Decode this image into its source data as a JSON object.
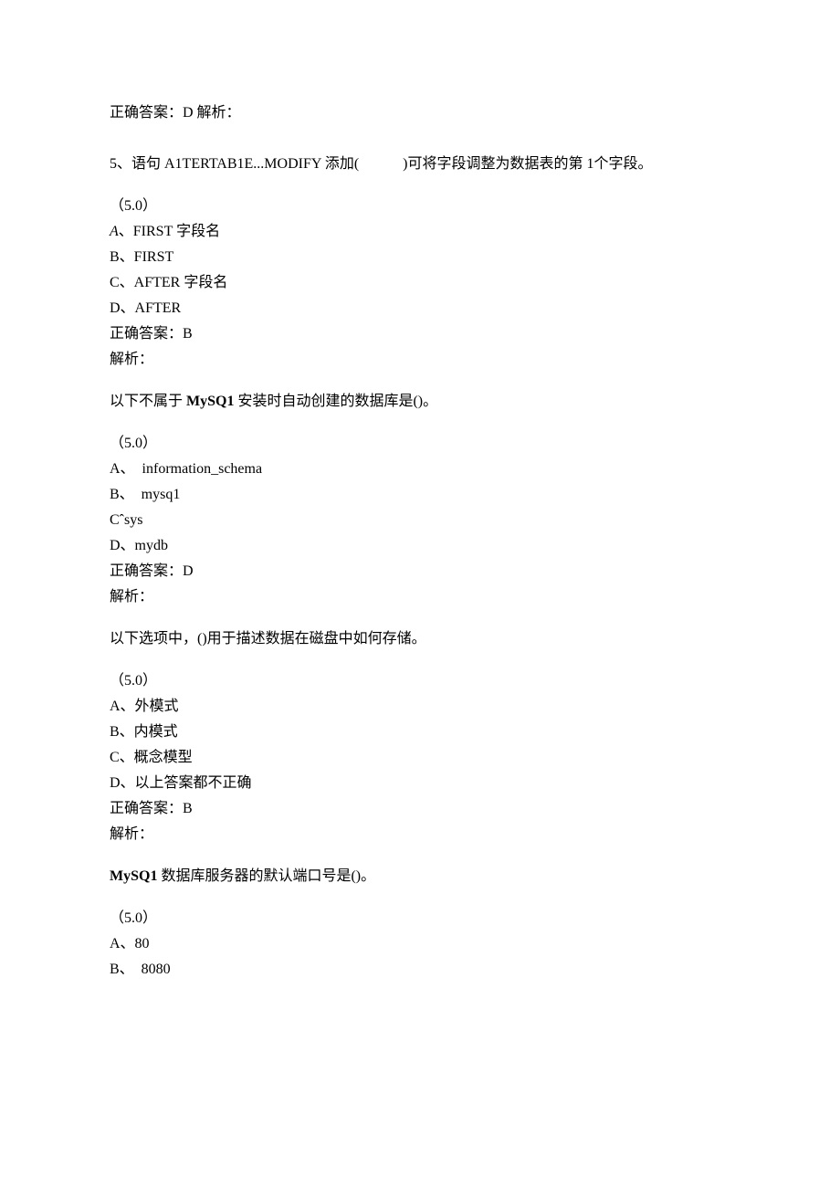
{
  "q4": {
    "answer_line": "正确答案：D 解析："
  },
  "q5": {
    "stem": "5、语句 A1TERTAB1E...MODIFY 添加(            )可将字段调整为数据表的第 1个字段。",
    "points": "（5.0）",
    "opt_a_label": "A",
    "opt_a_text": "、FIRST 字段名",
    "opt_b": "B、FIRST",
    "opt_c": "C、AFTER 字段名",
    "opt_d": "D、AFTER",
    "answer": "正确答案：B",
    "analysis": "解析："
  },
  "q6": {
    "stem_pre": "以下不属于 ",
    "stem_bold": "MySQ1",
    "stem_post": " 安装时自动创建的数据库是()。",
    "points": "（5.0）",
    "opt_a": "A、  information_schema",
    "opt_b": "B、  mysq1",
    "opt_c": "Cˆsys",
    "opt_d": "D、mydb",
    "answer": "正确答案：D",
    "analysis": "解析："
  },
  "q7": {
    "stem": "以下选项中，()用于描述数据在磁盘中如何存储。",
    "points": "（5.0）",
    "opt_a": "A、外模式",
    "opt_b": "B、内模式",
    "opt_c": "C、概念模型",
    "opt_d": "D、以上答案都不正确",
    "answer": "正确答案：B",
    "analysis": "解析："
  },
  "q8": {
    "stem_bold": "MySQ1",
    "stem_post": " 数据库服务器的默认端口号是()。",
    "points": "（5.0）",
    "opt_a": "A、80",
    "opt_b": "B、  8080"
  }
}
